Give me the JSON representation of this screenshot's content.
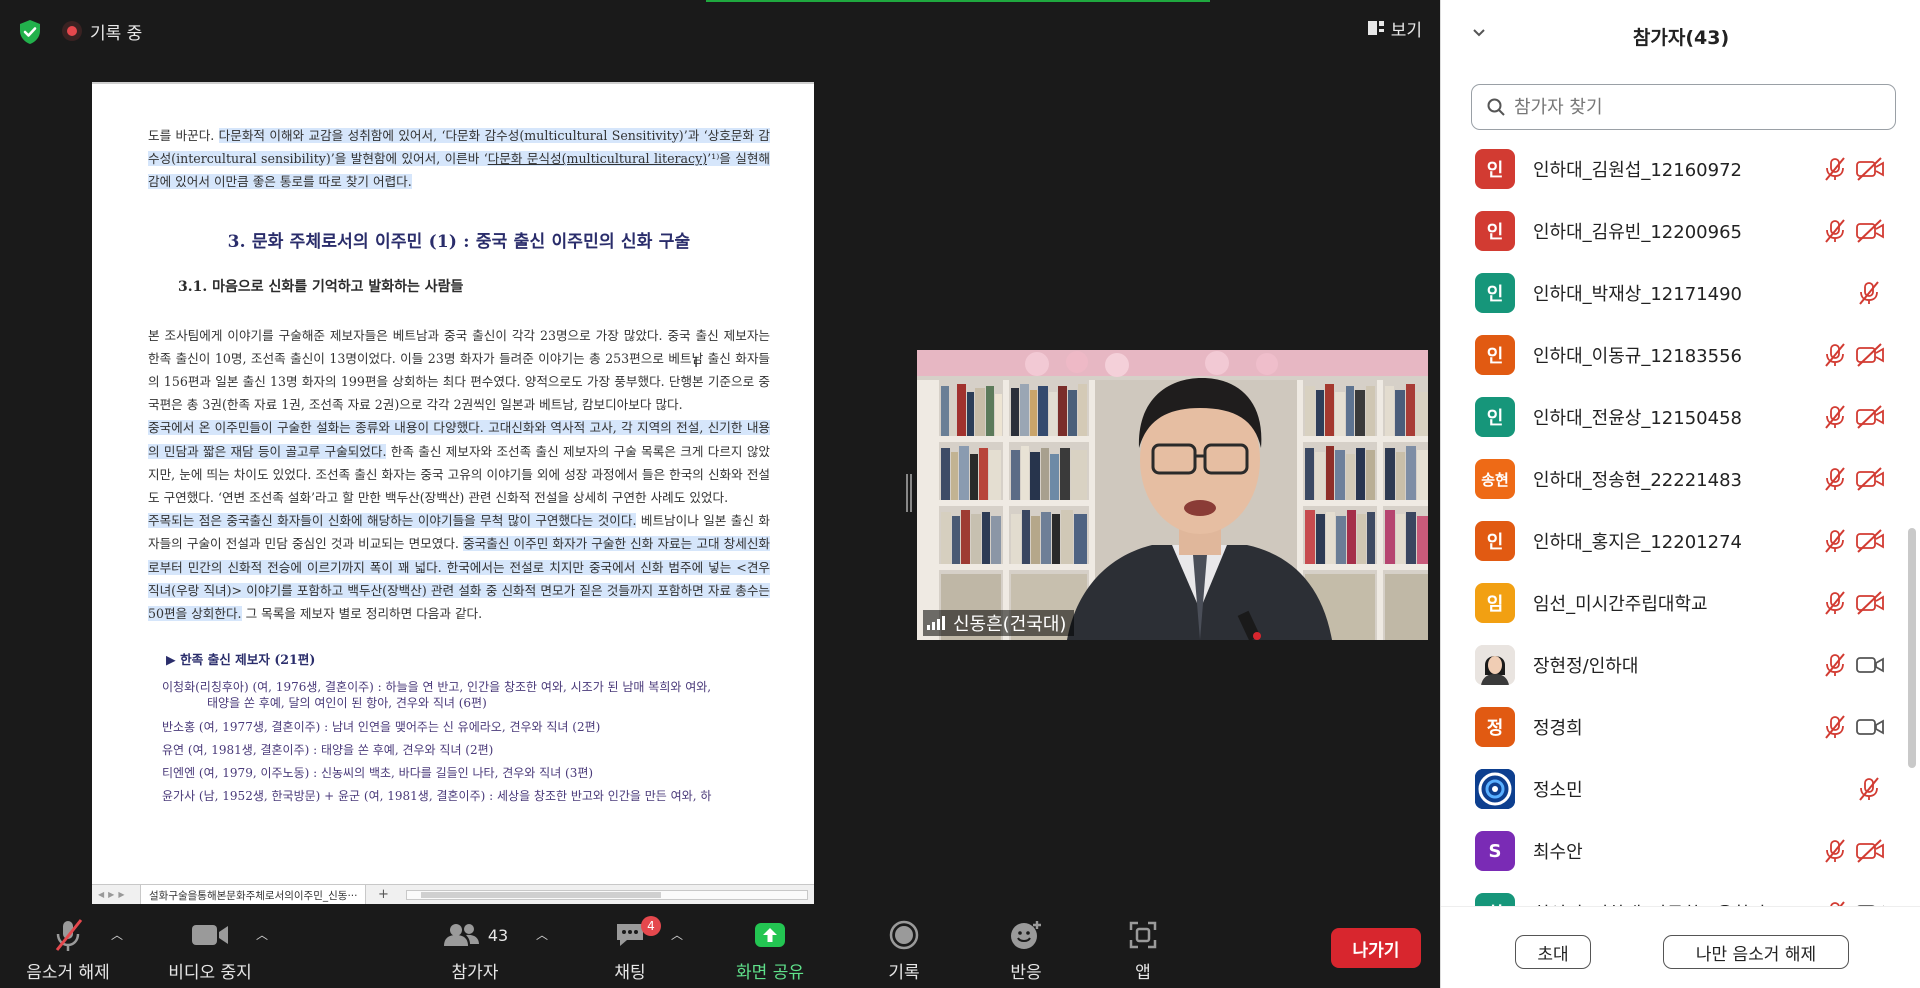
{
  "meeting": {
    "recording_label": "기록 중",
    "view_label": "보기"
  },
  "document": {
    "para1": [
      {
        "t": "도를 바꾼다. "
      },
      {
        "t": "다문화적 이해와 교감을 성취함에 있어서, ‘다문화 감수성(multicultural Sensitivity)’과 ‘상호문화 감수성(intercultural sensibility)’을 발현함에 있어서, 이른바 ‘",
        "hl": true
      },
      {
        "t": "다문화 문식성(multicultural literacy)",
        "hl": true,
        "ul": true
      },
      {
        "t": "’¹⁾을 실현해감에 있어서 이만큼 좋은 통로를 따로 찾기 어렵다.",
        "hl": true
      }
    ],
    "heading": "3. 문화 주체로서의 이주민 (1) : 중국 출신 이주민의 신화 구술",
    "subheading": "3.1. 마음으로 신화를 기억하고 발화하는 사람들",
    "para2": [
      {
        "t": "본 조사팀에게 이야기를 구술해준 제보자들은 베트남과 중국 출신이 각각 23명으로 가장 많았다. 중국 출신 제보자는 한족 출신이 10명, 조선족 출신이 13명이었다. 이들 23명 화자가 들려준 이야기는 총 253편으로 베트남 출신 화자들의 156편과 일본 출신 13명 화자의 199편을 상회하는 최다 편수였다. 양적으로도 가장 풍부했다. 단행본 기준으로 중국편은 총 3권(한족 자료 1권, 조선족 자료 2권)으로 각각 2권씩인 일본과 베트남, 캄보디아보다 많다."
      }
    ],
    "para3": [
      {
        "t": "중국에서 온 이주민들이 구술한 설화는 종류와 내용이 다양했다. 고대신화와 역사적 고사, 각 지역의 전설, 신기한 내용의 민담과 짧은 재담 등이 골고루 구술되었다.",
        "hl": true
      },
      {
        "t": " 한족 출신 제보자와 조선족 출신 제보자의 구술 목록은 크게 다르지 않았지만, 눈에 띄는 차이도 있었다. 조선족 출신 화자는 중국 고유의 이야기들 외에 성장 과정에서 들은 한국의 신화와 전설도 구연했다. ‘연변 조선족 설화’라고 할 만한 백두산(장백산) 관련 신화적 전설을 상세히 구연한 사례도 있었다."
      }
    ],
    "para4": [
      {
        "t": "주목되는 점은 중국출신 화자들이 신화에 해당하는 이야기들을 무척 많이 구연했다는 것이다.",
        "hl": true
      },
      {
        "t": " 베트남이나 일본 출신 화자들의 구술이 전설과 민담 중심인 것과 비교되는 면모였다. "
      },
      {
        "t": "중국출신 이주민 화자가 구술한 신화 자료는 고대 창세신화로부터 민간의 신화적 전승에 이르기까지 폭이 꽤 넓다. 한국에서는 전설로 치지만 중국에서 신화 범주에 넣는 <견우 직녀(우랑 직녀)> 이야기를 포함하고 백두산(장백산) 관련 설화 중 신화적 면모가 짙은 것들까지 포함하면 자료 총수는 50편을 상회한다.",
        "hl": true
      },
      {
        "t": " 그 목록을 제보자 별로 정리하면 다음과 같다."
      }
    ],
    "list_heading": "▶ 한족 출신 제보자 (21편)",
    "list_items": [
      {
        "main": "이청화(리칭후아) (여, 1976생, 결혼이주) : 하늘을 연 반고, 인간을 창조한 여와, 시조가 된 남매 복희와 여와,",
        "cont": "태양을 쏜 후예, 달의 여인이 된 항아, 견우와 직녀 (6편)"
      },
      {
        "main": "반소홍 (여, 1977생, 결혼이주) : 남녀 인연을 맺어주는 신 유에라오, 견우와 직녀 (2편)"
      },
      {
        "main": "유연 (여, 1981생, 결혼이주) : 태양을 쏜 후예, 견우와 직녀 (2편)"
      },
      {
        "main": "티엔엔 (여, 1979, 이주노동) : 신농씨의 백초, 바다를 길들인 나타, 견우와 직녀 (3편)"
      },
      {
        "main": "윤가사 (남, 1952생, 한국방문) + 윤군 (여, 1981생, 결혼이주) : 세상을 창조한 반고와 인간을 만든 여와, 하"
      }
    ],
    "sheet_tab": "설화구술을통해본문화주체로서의이주민_신동···",
    "add_tab": "+"
  },
  "speaker": {
    "name": "신동흔(건국대)"
  },
  "toolbar": {
    "unmute": "음소거 해제",
    "stop_video": "비디오 중지",
    "participants": "참가자",
    "participants_count": "43",
    "chat": "채팅",
    "chat_badge": "4",
    "share_screen": "화면 공유",
    "record": "기록",
    "reactions": "반응",
    "apps": "앱",
    "leave": "나가기"
  },
  "panel": {
    "title": "참가자(43)",
    "search_placeholder": "참가자 찾기",
    "invite": "초대",
    "unmute_me": "나만 음소거 해제",
    "participants": [
      {
        "avatar": "인",
        "color": "#d23b32",
        "name": "인하대_김원섭_12160972",
        "mic": "muted",
        "cam": "off"
      },
      {
        "avatar": "인",
        "color": "#d23b32",
        "name": "인하대_김유빈_12200965",
        "mic": "muted",
        "cam": "off"
      },
      {
        "avatar": "인",
        "color": "#16967a",
        "name": "인하대_박재상_12171490",
        "mic": "muted",
        "cam": "none"
      },
      {
        "avatar": "인",
        "color": "#e15a12",
        "name": "인하대_이동규_12183556",
        "mic": "muted",
        "cam": "off"
      },
      {
        "avatar": "인",
        "color": "#16967a",
        "name": "인하대_전윤상_12150458",
        "mic": "muted",
        "cam": "off"
      },
      {
        "avatar": "송현",
        "color": "#ee6a16",
        "name": "인하대_정송현_22221483",
        "mic": "muted",
        "cam": "off"
      },
      {
        "avatar": "인",
        "color": "#e15a12",
        "name": "인하대_홍지은_12201274",
        "mic": "muted",
        "cam": "off"
      },
      {
        "avatar": "임",
        "color": "#f2a012",
        "name": "임선_미시간주립대학교",
        "mic": "muted",
        "cam": "off"
      },
      {
        "avatar": "photo",
        "color": "#e9e4e0",
        "name": "장현정/인하대",
        "mic": "muted",
        "cam": "on"
      },
      {
        "avatar": "정",
        "color": "#e15a12",
        "name": "정경희",
        "mic": "muted",
        "cam": "on"
      },
      {
        "avatar": "logo",
        "color": "#0d3f8f",
        "name": "정소민",
        "mic": "muted",
        "cam": "none"
      },
      {
        "avatar": "S",
        "color": "#7a2bb5",
        "name": "최수안",
        "mic": "muted",
        "cam": "off"
      },
      {
        "avatar": "최",
        "color": "#16967a",
        "name": "최선정_인하대_다문화교육학과",
        "mic": "muted",
        "cam": "on"
      }
    ]
  }
}
